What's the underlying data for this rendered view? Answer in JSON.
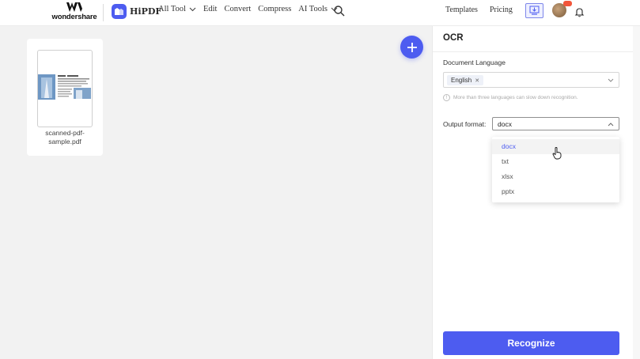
{
  "header": {
    "brand": "wondershare",
    "product": "HiPDF",
    "nav": [
      {
        "label": "All Tool",
        "has_dropdown": true
      },
      {
        "label": "Edit",
        "has_dropdown": false
      },
      {
        "label": "Convert",
        "has_dropdown": false
      },
      {
        "label": "Compress",
        "has_dropdown": false
      },
      {
        "label": "AI Tools",
        "has_dropdown": true
      }
    ],
    "templates": "Templates",
    "pricing": "Pricing"
  },
  "workspace": {
    "file_name": "scanned-pdf-sample.pdf"
  },
  "panel": {
    "title": "OCR",
    "language_label": "Document Language",
    "selected_language": "English",
    "hint": "More than three languages can slow down recognition.",
    "format_label": "Output format:",
    "format_value": "docx",
    "format_options": [
      "docx",
      "txt",
      "xlsx",
      "pptx"
    ],
    "active_option": "docx",
    "recognize_label": "Recognize"
  },
  "colors": {
    "accent": "#4d5cf0",
    "workspace_bg": "#f2f2f2"
  },
  "icons": [
    "search-icon",
    "download-icon",
    "bell-icon",
    "plus-icon",
    "close-icon",
    "chevron-down-icon",
    "chevron-up-icon",
    "info-icon",
    "hand-cursor-icon"
  ]
}
